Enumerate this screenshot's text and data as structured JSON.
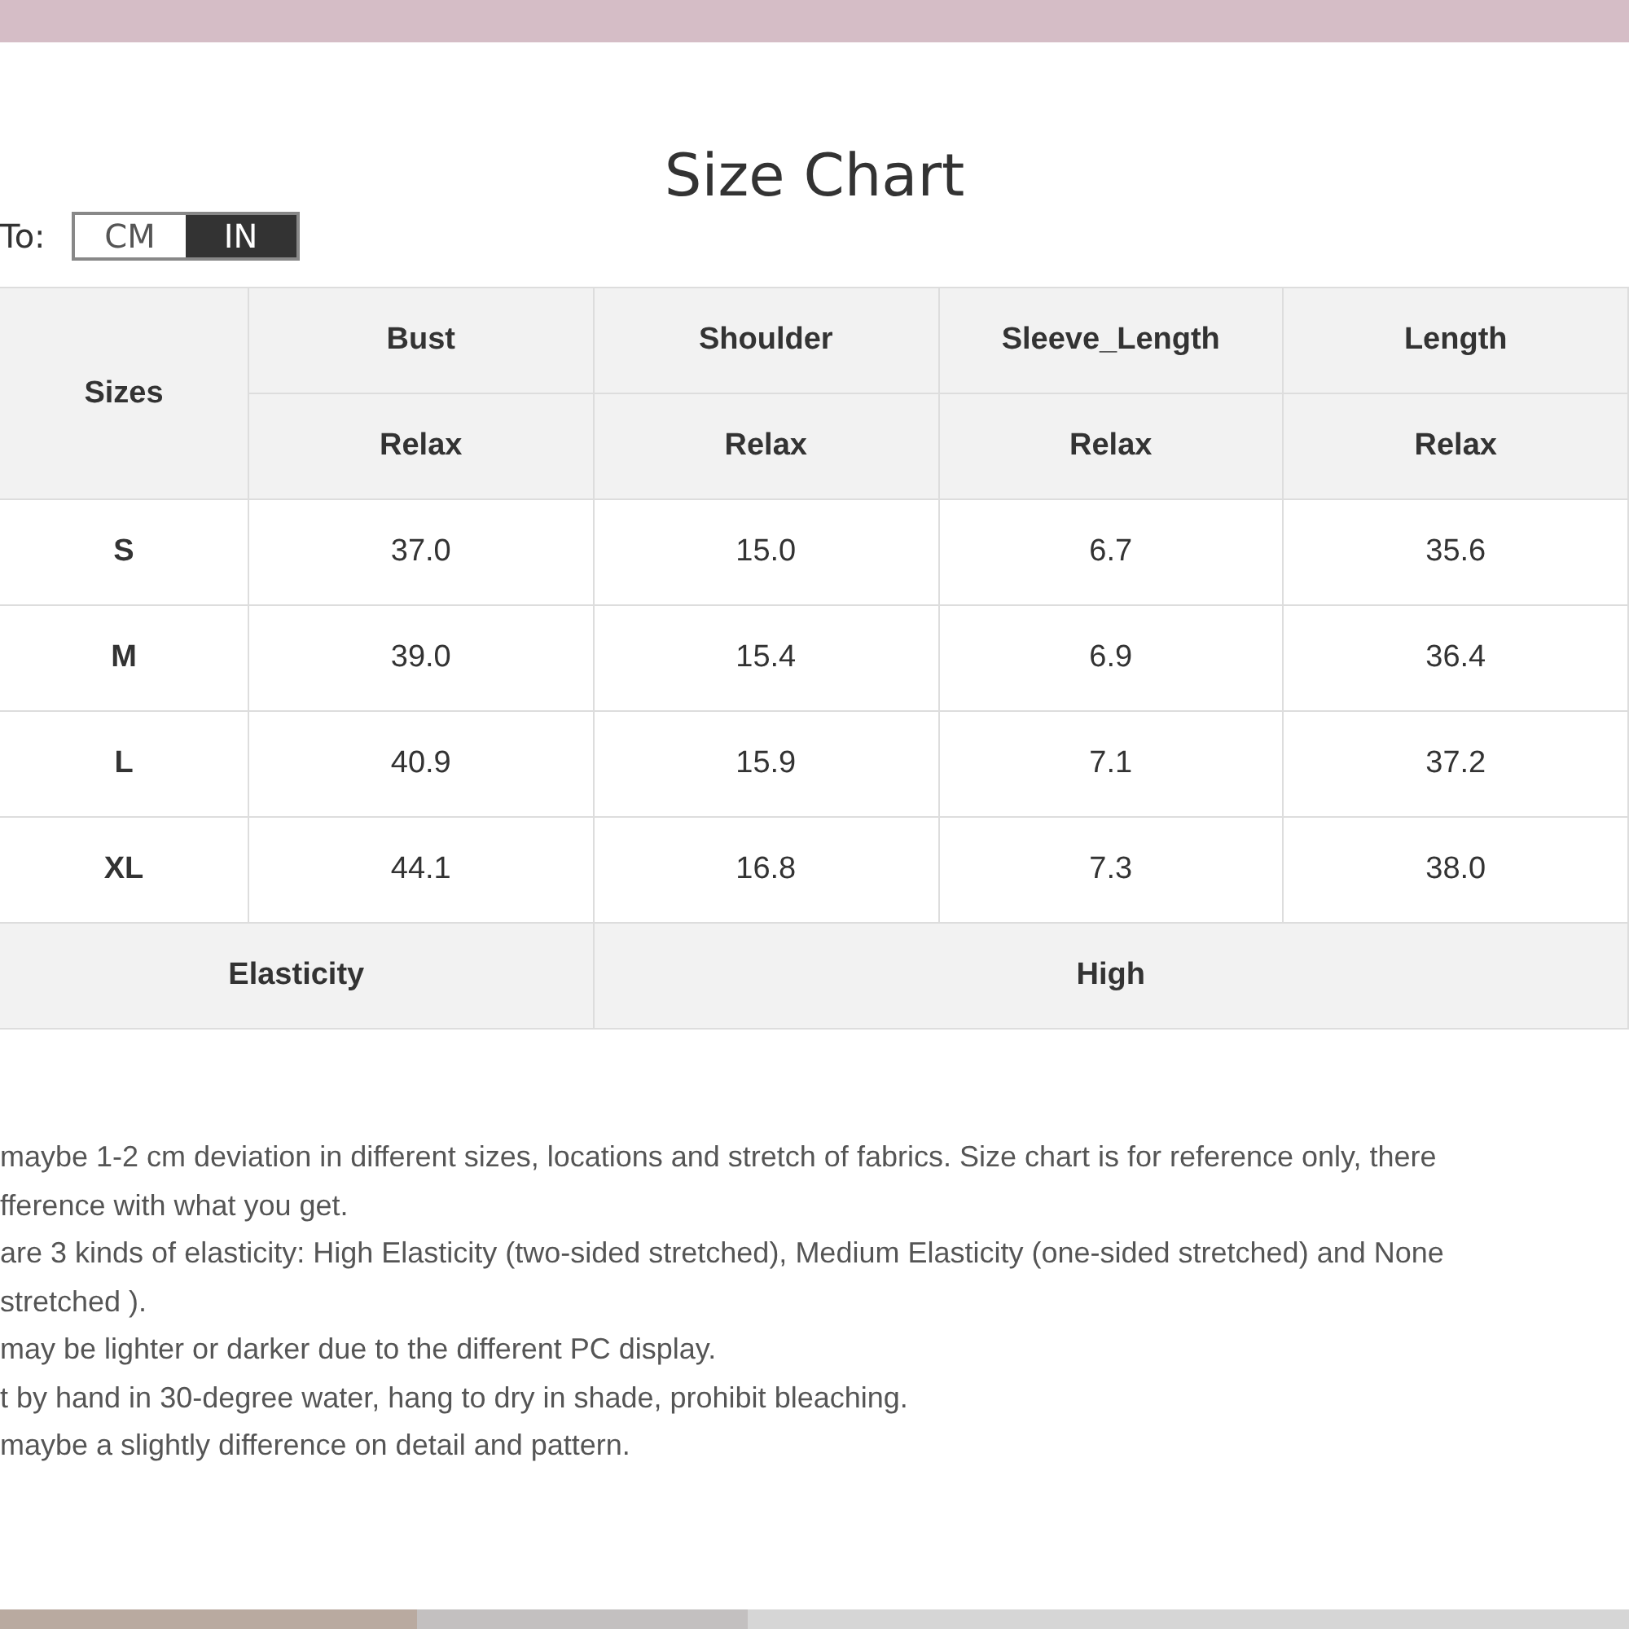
{
  "title": "Size Chart",
  "unit_switch": {
    "label": "To:",
    "options": [
      {
        "label": "CM",
        "selected": false
      },
      {
        "label": "IN",
        "selected": true
      }
    ]
  },
  "table": {
    "corner": "Sizes",
    "columns": [
      {
        "name": "Bust",
        "sub": "Relax"
      },
      {
        "name": "Shoulder",
        "sub": "Relax"
      },
      {
        "name": "Sleeve_Length",
        "sub": "Relax"
      },
      {
        "name": "Length",
        "sub": "Relax"
      }
    ],
    "rows": [
      {
        "size": "S",
        "values": [
          "37.0",
          "15.0",
          "6.7",
          "35.6"
        ]
      },
      {
        "size": "M",
        "values": [
          "39.0",
          "15.4",
          "6.9",
          "36.4"
        ]
      },
      {
        "size": "L",
        "values": [
          "40.9",
          "15.9",
          "7.1",
          "37.2"
        ]
      },
      {
        "size": "XL",
        "values": [
          "44.1",
          "16.8",
          "7.3",
          "38.0"
        ]
      }
    ],
    "footer": {
      "label": "Elasticity",
      "value": "High"
    }
  },
  "notes": [
    "maybe 1-2 cm deviation in different sizes, locations and stretch of fabrics. Size chart is for reference only, there",
    "fference with what you get.",
    "are 3 kinds of elasticity: High Elasticity (two-sided stretched), Medium Elasticity (one-sided stretched) and None",
    "stretched ).",
    "may be lighter or darker due to the different PC display.",
    "t by hand in 30-degree water, hang to dry in shade, prohibit bleaching.",
    "maybe a slightly difference on detail and pattern."
  ]
}
